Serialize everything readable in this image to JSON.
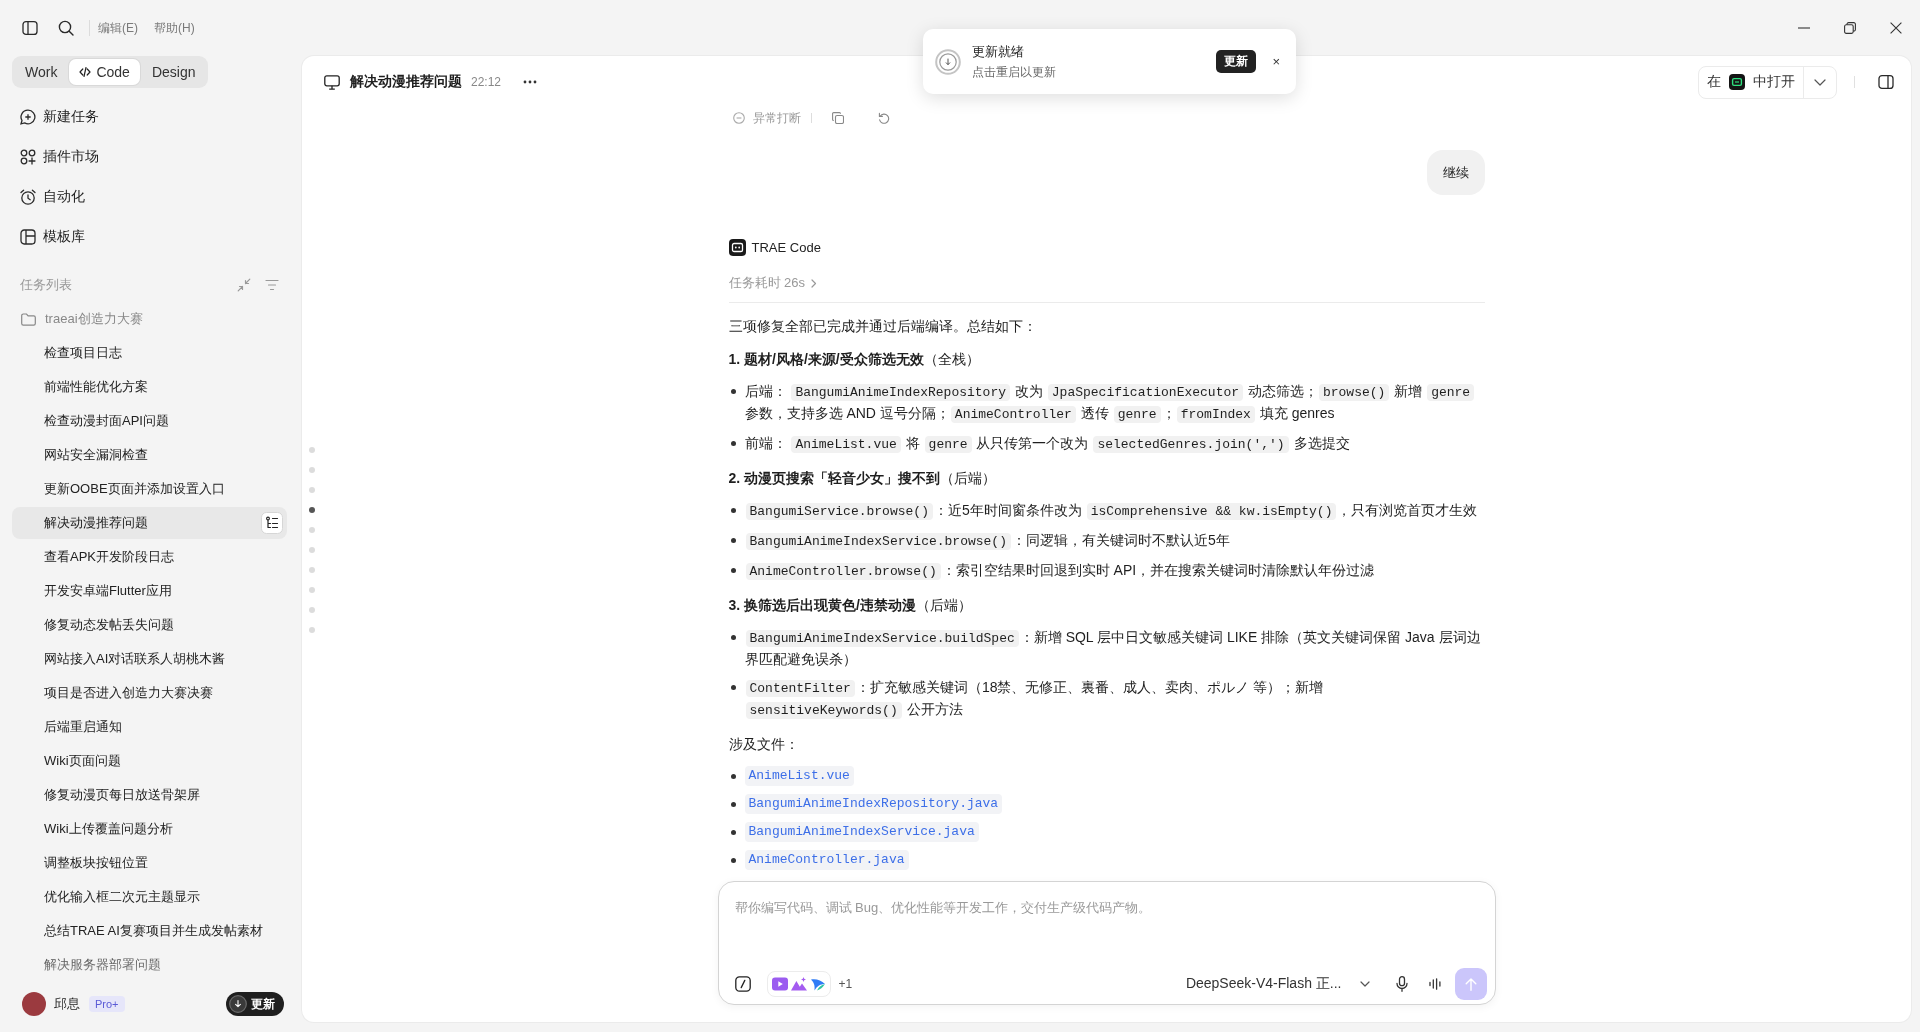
{
  "titlebar": {
    "menu": [
      "编辑(E)",
      "帮助(H)"
    ]
  },
  "mode_tabs": [
    {
      "label": "Work",
      "selected": false
    },
    {
      "label": "Code",
      "selected": true
    },
    {
      "label": "Design",
      "selected": false
    }
  ],
  "nav": [
    {
      "label": "新建任务"
    },
    {
      "label": "插件市场"
    },
    {
      "label": "自动化"
    },
    {
      "label": "模板库"
    }
  ],
  "task_list": {
    "title": "任务列表",
    "folder": {
      "label": "traeai创造力大赛",
      "children": [
        {
          "label": "检查项目日志",
          "selected": false
        },
        {
          "label": "前端性能优化方案",
          "selected": false
        },
        {
          "label": "检查动漫封面API问题",
          "selected": false
        },
        {
          "label": "网站安全漏洞检查",
          "selected": false
        },
        {
          "label": "更新OOBE页面并添加设置入口",
          "selected": false
        },
        {
          "label": "解决动漫推荐问题",
          "selected": true
        },
        {
          "label": "查看APK开发阶段日志",
          "selected": false
        },
        {
          "label": "开发安卓端Flutter应用",
          "selected": false
        },
        {
          "label": "修复动态发帖丢失问题",
          "selected": false
        },
        {
          "label": "网站接入AI对话联系人胡桃木酱",
          "selected": false
        },
        {
          "label": "项目是否进入创造力大赛决赛",
          "selected": false
        },
        {
          "label": "后端重启通知",
          "selected": false
        },
        {
          "label": "Wiki页面问题",
          "selected": false
        },
        {
          "label": "修复动漫页每日放送骨架屏",
          "selected": false
        },
        {
          "label": "Wiki上传覆盖问题分析",
          "selected": false
        },
        {
          "label": "调整板块按钮位置",
          "selected": false
        },
        {
          "label": "优化输入框二次元主题显示",
          "selected": false
        },
        {
          "label": "总结TRAE AI复赛项目并生成发帖素材",
          "selected": false
        },
        {
          "label": "解决服务器部署问题",
          "selected": false
        }
      ]
    }
  },
  "user": {
    "name": "邱息",
    "plan": "Pro+",
    "update_button": "更新"
  },
  "header": {
    "title": "解决动漫推荐问题",
    "time": "22:12",
    "open_in": {
      "prefix": "在",
      "suffix": "中打开"
    }
  },
  "toast": {
    "title": "更新就绪",
    "message": "点击重启以更新",
    "action": "更新",
    "close": "×"
  },
  "timeline": [
    {
      "selected": false
    },
    {
      "selected": false
    },
    {
      "selected": false
    },
    {
      "selected": true
    },
    {
      "selected": false
    },
    {
      "selected": false
    },
    {
      "selected": false
    },
    {
      "selected": false
    },
    {
      "selected": false
    },
    {
      "selected": false
    }
  ],
  "messages": {
    "interrupted": "异常打断",
    "user": "继续",
    "assistant": {
      "name": "TRAE Code",
      "duration": "任务耗时 26s",
      "intro": "三项修复全部已完成并通过后端编译。总结如下：",
      "sections": [
        {
          "heading": "**1. 题材/风格/来源/受众筛选无效**（全栈）",
          "bullets": [
            {
              "parts": [
                {
                  "kind": "text",
                  "text": "后端： "
                },
                {
                  "kind": "code",
                  "text": "BangumiAnimeIndexRepository"
                },
                {
                  "kind": "text",
                  "text": " 改为 "
                },
                {
                  "kind": "code",
                  "text": "JpaSpecificationExecutor"
                },
                {
                  "kind": "text",
                  "text": " 动态筛选；"
                },
                {
                  "kind": "code",
                  "text": "browse()"
                },
                {
                  "kind": "text",
                  "text": " 新增 "
                },
                {
                  "kind": "code",
                  "text": "genre"
                },
                {
                  "kind": "text",
                  "text": " 参数，支持多选 AND 逗号分隔；"
                },
                {
                  "kind": "code",
                  "text": "AnimeController"
                },
                {
                  "kind": "text",
                  "text": " 透传 "
                },
                {
                  "kind": "code",
                  "text": "genre"
                },
                {
                  "kind": "text",
                  "text": "；"
                },
                {
                  "kind": "code",
                  "text": "fromIndex"
                },
                {
                  "kind": "text",
                  "text": " 填充 genres"
                }
              ]
            },
            {
              "parts": [
                {
                  "kind": "text",
                  "text": "前端： "
                },
                {
                  "kind": "code",
                  "text": "AnimeList.vue"
                },
                {
                  "kind": "text",
                  "text": " 将 "
                },
                {
                  "kind": "code",
                  "text": "genre"
                },
                {
                  "kind": "text",
                  "text": " 从只传第一个改为 "
                },
                {
                  "kind": "code",
                  "text": "selectedGenres.join(',')"
                },
                {
                  "kind": "text",
                  "text": " 多选提交"
                }
              ]
            }
          ]
        },
        {
          "heading": "**2. 动漫页搜索「轻音少女」搜不到**（后端）",
          "bullets": [
            {
              "parts": [
                {
                  "kind": "code",
                  "text": "BangumiService.browse()"
                },
                {
                  "kind": "text",
                  "text": "：近5年时间窗条件改为 "
                },
                {
                  "kind": "code",
                  "text": "isComprehensive && kw.isEmpty()"
                },
                {
                  "kind": "text",
                  "text": "，只有浏览首页才生效"
                }
              ]
            },
            {
              "parts": [
                {
                  "kind": "code",
                  "text": "BangumiAnimeIndexService.browse()"
                },
                {
                  "kind": "text",
                  "text": "：同逻辑，有关键词时不默认近5年"
                }
              ]
            },
            {
              "parts": [
                {
                  "kind": "code",
                  "text": "AnimeController.browse()"
                },
                {
                  "kind": "text",
                  "text": "：索引空结果时回退到实时 API，并在搜索关键词时清除默认年份过滤"
                }
              ]
            }
          ]
        },
        {
          "heading": "**3. 换筛选后出现黄色/违禁动漫**（后端）",
          "bullets": [
            {
              "parts": [
                {
                  "kind": "code",
                  "text": "BangumiAnimeIndexService.buildSpec"
                },
                {
                  "kind": "text",
                  "text": "：新增 SQL 层中日文敏感关键词 LIKE 排除（英文关键词保留 Java 层词边界匹配避免误杀）"
                }
              ]
            },
            {
              "parts": [
                {
                  "kind": "code",
                  "text": "ContentFilter"
                },
                {
                  "kind": "text",
                  "text": "：扩充敏感关键词（18禁、无修正、裏番、成人、卖肉、ポルノ 等）；新增 "
                },
                {
                  "kind": "code",
                  "text": "sensitiveKeywords()"
                },
                {
                  "kind": "text",
                  "text": " 公开方法"
                }
              ]
            }
          ]
        }
      ],
      "files_label": "涉及文件：",
      "files": [
        "AnimeList.vue",
        "BangumiAnimeIndexRepository.java",
        "BangumiAnimeIndexService.java",
        "AnimeController.java"
      ]
    }
  },
  "composer": {
    "placeholder": "帮你编写代码、调试 Bug、优化性能等开发工作，交付生产级代码产物。",
    "extra_count": "+1",
    "model": "DeepSeek-V4-Flash 正...",
    "send": {
      "disabled": true
    }
  }
}
